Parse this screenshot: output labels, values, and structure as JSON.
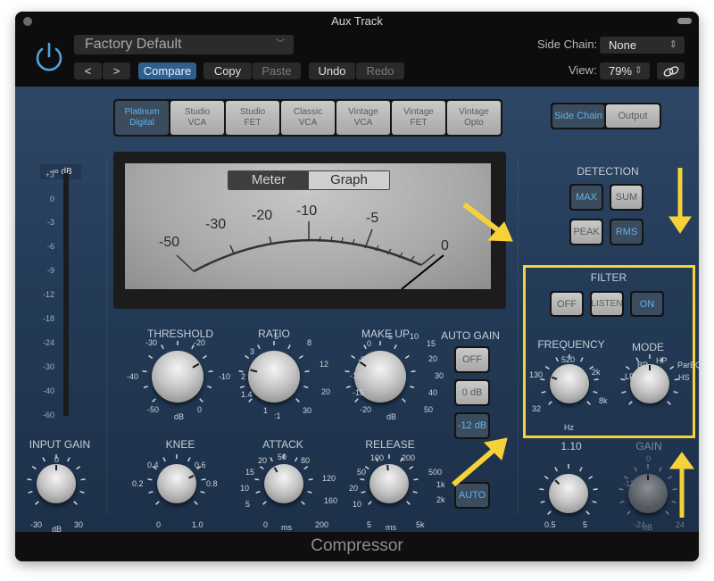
{
  "window": {
    "title": "Aux Track",
    "footer_title": "Compressor"
  },
  "header": {
    "preset": "Factory Default",
    "nav_prev": "<",
    "nav_next": ">",
    "compare": "Compare",
    "copy": "Copy",
    "paste": "Paste",
    "undo": "Undo",
    "redo": "Redo",
    "side_chain_label": "Side Chain:",
    "side_chain_value": "None",
    "view_label": "View:",
    "view_value": "79%",
    "icons": {
      "power": "power-icon",
      "link": "link-icon",
      "chevron": "chevron-down-icon",
      "updown": "up-down-icon"
    }
  },
  "models": [
    {
      "label": "Platinum\nDigital",
      "selected": true
    },
    {
      "label": "Studio\nVCA",
      "selected": false
    },
    {
      "label": "Studio\nFET",
      "selected": false
    },
    {
      "label": "Classic\nVCA",
      "selected": false
    },
    {
      "label": "Vintage\nVCA",
      "selected": false
    },
    {
      "label": "Vintage\nFET",
      "selected": false
    },
    {
      "label": "Vintage\nOpto",
      "selected": false
    }
  ],
  "sidechain_output": {
    "side_chain": "Side Chain",
    "output": "Output",
    "selected": "Side Chain"
  },
  "input_meter": {
    "readout": "-∞ dB",
    "scale": [
      "+3",
      "0",
      "-3",
      "-6",
      "-9",
      "-12",
      "-18",
      "-24",
      "-30",
      "-40",
      "-60"
    ]
  },
  "meter": {
    "tabs": {
      "meter": "Meter",
      "graph": "Graph"
    },
    "selected_tab": "Meter",
    "scale": [
      "-50",
      "-30",
      "-20",
      "-10",
      "-5",
      "0"
    ]
  },
  "detection": {
    "title": "DETECTION",
    "max": "MAX",
    "sum": "SUM",
    "peak": "PEAK",
    "rms": "RMS",
    "selected": [
      "MAX",
      "RMS"
    ]
  },
  "filter": {
    "title": "FILTER",
    "off": "OFF",
    "listen": "LISTEN",
    "on": "ON",
    "selected": "ON",
    "frequency": {
      "label": "FREQUENCY",
      "ticks": [
        "32",
        "130",
        "520",
        "2k",
        "8k"
      ],
      "unit": "Hz"
    },
    "mode": {
      "label": "MODE",
      "ticks": [
        "LP",
        "BP",
        "HP",
        "ParEQ",
        "HS"
      ],
      "value": "HP"
    },
    "q_value": "1.10",
    "q_ticks": [
      "0.5",
      "5"
    ],
    "gain": {
      "label": "GAIN",
      "ticks": [
        "0",
        "-12",
        "-24",
        "24"
      ],
      "unit": "dB"
    }
  },
  "knobs": {
    "threshold": {
      "label": "THRESHOLD",
      "ticks": [
        "-30",
        "-20",
        "-40",
        "-10",
        "-50",
        "0"
      ],
      "unit": "dB"
    },
    "ratio": {
      "label": "RATIO",
      "ticks": [
        "5",
        "8",
        "3",
        "12",
        "2",
        "20",
        "1.4",
        "1",
        "30"
      ],
      "unit": ":1"
    },
    "makeup": {
      "label": "MAKE UP",
      "ticks": [
        "5",
        "10",
        "0",
        "15",
        "-5",
        "20",
        "-10",
        "30",
        "-15",
        "40",
        "-20",
        "50"
      ],
      "unit": "dB"
    },
    "input_gain": {
      "label": "INPUT GAIN",
      "ticks": [
        "0",
        "-30",
        "30"
      ],
      "unit": "dB"
    },
    "knee": {
      "label": "KNEE",
      "ticks": [
        "0.4",
        "0.6",
        "0.2",
        "0.8",
        "0",
        "1.0"
      ]
    },
    "attack": {
      "label": "ATTACK",
      "ticks": [
        "20",
        "50",
        "80",
        "15",
        "120",
        "10",
        "160",
        "5",
        "0",
        "200"
      ],
      "unit": "ms"
    },
    "release": {
      "label": "RELEASE",
      "ticks": [
        "100",
        "200",
        "50",
        "500",
        "20",
        "1k",
        "10",
        "2k",
        "5",
        "5k"
      ],
      "unit": "ms"
    }
  },
  "auto_gain": {
    "title": "AUTO GAIN",
    "off": "OFF",
    "zero": "0 dB",
    "minus12": "-12 dB",
    "selected": "-12 dB",
    "auto": "AUTO"
  },
  "annotations": {
    "color": "#f5d23a",
    "highlight_box": "FILTER section"
  }
}
